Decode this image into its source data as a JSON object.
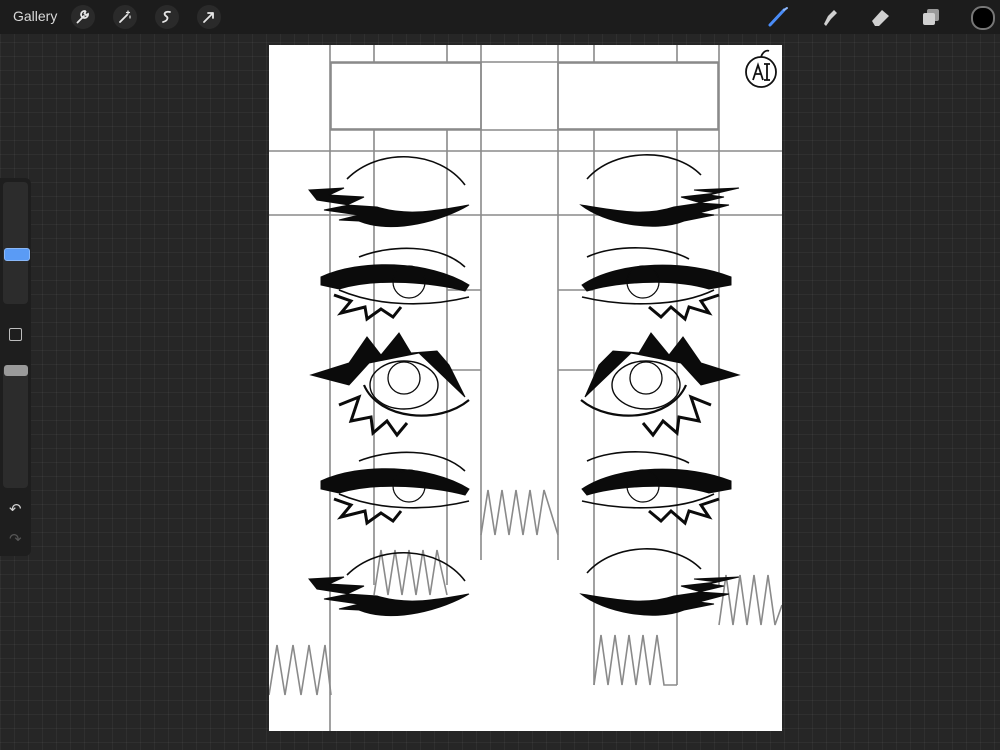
{
  "toolbar": {
    "gallery_label": "Gallery",
    "left_tools": [
      "wrench-icon",
      "magic-wand-icon",
      "selection-icon",
      "transform-icon"
    ],
    "right_tools": [
      "brush-icon",
      "smudge-icon",
      "eraser-icon",
      "layers-icon"
    ],
    "active_tool": "brush-icon",
    "accent_color": "#4a8cf7",
    "current_color": "#000000"
  },
  "sidebar": {
    "tools": [
      "brush-size-slider",
      "modify-button",
      "opacity-slider",
      "undo-icon",
      "redo-icon"
    ]
  },
  "canvas": {
    "background": "#ffffff",
    "line_color": "#111111",
    "guide_color": "#8a8a8a"
  }
}
